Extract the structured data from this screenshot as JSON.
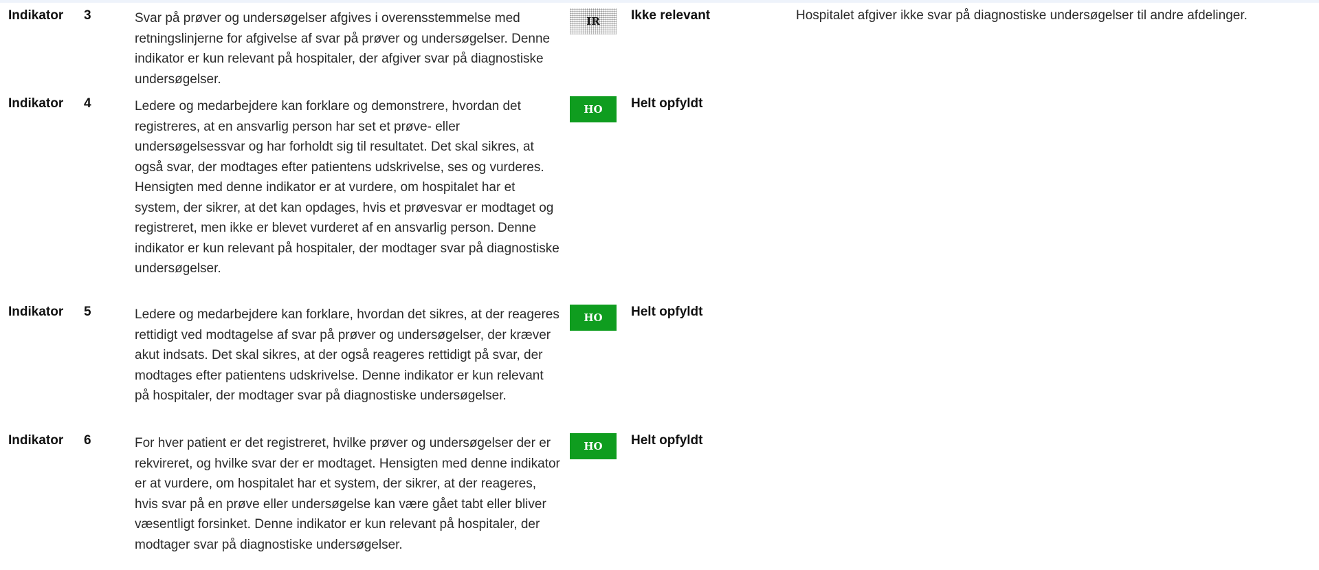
{
  "rows": [
    {
      "label": "Indikator",
      "number": "3",
      "description": "Svar på prøver og undersøgelser afgives i overensstemmelse med retningslinjerne for afgivelse af svar på prøver og undersøgelser.   Denne indikator er kun relevant på hospitaler, der afgiver svar på diagnostiske undersøgelser.",
      "badge": "IR",
      "status": "Ikke relevant",
      "comment": "Hospitalet afgiver ikke svar på diagnostiske undersøgelser til andre afdelinger."
    },
    {
      "label": "Indikator",
      "number": "4",
      "description": "Ledere og medarbejdere kan forklare og demonstrere, hvordan det registreres, at en ansvarlig person har set et prøve- eller undersøgelsessvar og har forholdt sig til resultatet. Det skal sikres, at også svar, der modtages efter patientens udskrivelse, ses og vurderes.   Hensigten med denne indikator er at vurdere, om hospitalet har et system, der sikrer, at det kan opdages, hvis et prøvesvar er modtaget og registreret, men ikke er blevet vurderet af en ansvarlig person.   Denne indikator er kun relevant på hospitaler, der modtager svar på diagnostiske undersøgelser.",
      "badge": "HO",
      "status": "Helt opfyldt",
      "comment": ""
    },
    {
      "label": "Indikator",
      "number": "5",
      "description": "Ledere og medarbejdere kan forklare, hvordan det sikres, at der reageres rettidigt ved modtagelse af svar på prøver og undersøgelser, der kræver akut indsats. Det skal sikres, at der også reageres rettidigt på svar, der modtages efter patientens udskrivelse.   Denne indikator er kun relevant på hospitaler, der modtager svar på diagnostiske undersøgelser.",
      "badge": "HO",
      "status": "Helt opfyldt",
      "comment": ""
    },
    {
      "label": "Indikator",
      "number": "6",
      "description": "For hver patient er det registreret, hvilke prøver og undersøgelser der er rekvireret, og hvilke svar der er modtaget.   Hensigten med denne indikator er at vurdere, om hospitalet har et system, der sikrer, at der reageres, hvis svar på en prøve eller undersøgelse kan være gået tabt eller bliver væsentligt forsinket.   Denne indikator er kun relevant på hospitaler, der modtager svar på diagnostiske undersøgelser.",
      "badge": "HO",
      "status": "Helt opfyldt",
      "comment": ""
    }
  ]
}
